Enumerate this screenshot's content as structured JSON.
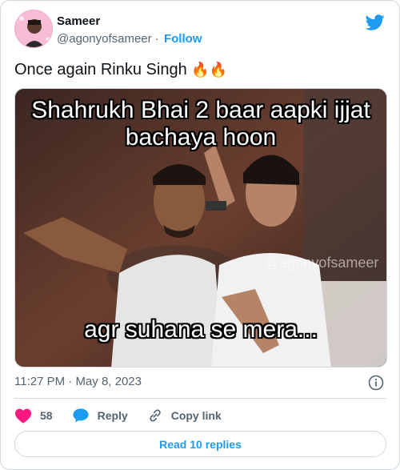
{
  "author": {
    "name": "Sameer",
    "handle": "@agonyofsameer",
    "separator": "·",
    "follow_label": "Follow"
  },
  "tweet": {
    "text": "Once again Rinku Singh",
    "emoji": "🔥🔥"
  },
  "media": {
    "caption_top": "Shahrukh Bhai 2 baar aapki ijjat bachaya hoon",
    "caption_bottom": "agr suhana se mera...",
    "watermark": "@agonyofsameer"
  },
  "meta": {
    "time": "11:27 PM",
    "separator": "·",
    "date": "May 8, 2023"
  },
  "actions": {
    "likes": "58",
    "reply_label": "Reply",
    "copy_link_label": "Copy link"
  },
  "read_replies_label": "Read 10 replies",
  "colors": {
    "accent": "#1d9bf0",
    "like": "#f91880",
    "text": "#0f1419",
    "muted": "#536471",
    "border": "#cfd9de"
  }
}
